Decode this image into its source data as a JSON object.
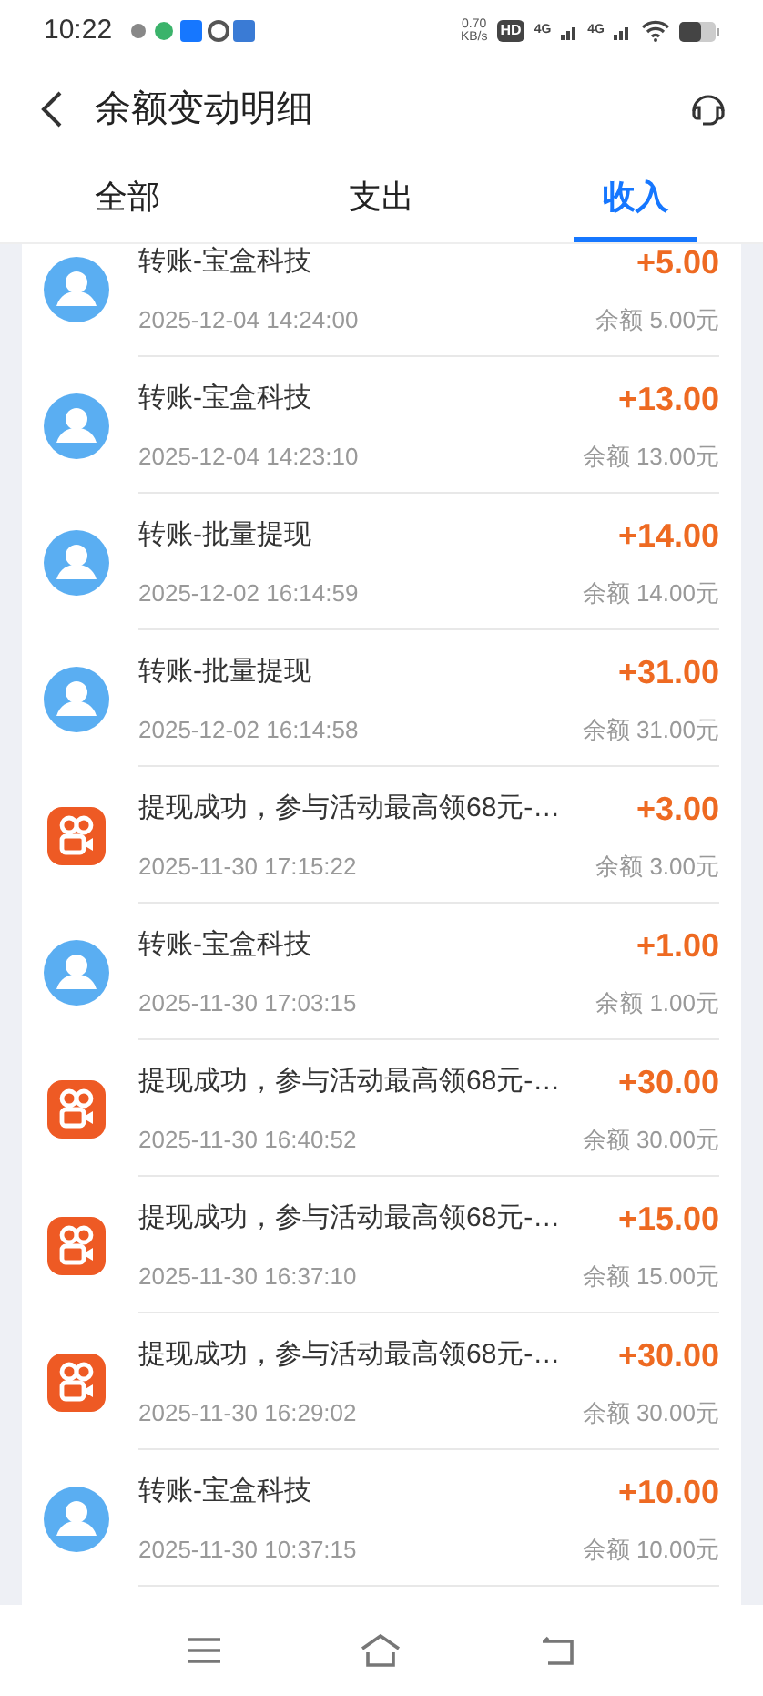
{
  "status_bar": {
    "time": "10:22",
    "net_speed": "0.70",
    "net_unit": "KB/s",
    "hd": "HD",
    "signal_1": "4G",
    "signal_2": "4G"
  },
  "header": {
    "title": "余额变动明细"
  },
  "tabs": [
    {
      "label": "全部",
      "selected": false
    },
    {
      "label": "支出",
      "selected": false
    },
    {
      "label": "收入",
      "selected": true
    }
  ],
  "records": [
    {
      "kind": "person",
      "title": "转账-宝盒科技",
      "time": "2025-12-04 14:24:00",
      "amount": "+5.00",
      "balance": "余额 5.00元"
    },
    {
      "kind": "person",
      "title": "转账-宝盒科技",
      "time": "2025-12-04 14:23:10",
      "amount": "+13.00",
      "balance": "余额 13.00元"
    },
    {
      "kind": "person",
      "title": "转账-批量提现",
      "time": "2025-12-02 16:14:59",
      "amount": "+14.00",
      "balance": "余额 14.00元"
    },
    {
      "kind": "person",
      "title": "转账-批量提现",
      "time": "2025-12-02 16:14:58",
      "amount": "+31.00",
      "balance": "余额 31.00元"
    },
    {
      "kind": "app",
      "title": "提现成功，参与活动最高领68元-…",
      "time": "2025-11-30 17:15:22",
      "amount": "+3.00",
      "balance": "余额 3.00元"
    },
    {
      "kind": "person",
      "title": "转账-宝盒科技",
      "time": "2025-11-30 17:03:15",
      "amount": "+1.00",
      "balance": "余额 1.00元"
    },
    {
      "kind": "app",
      "title": "提现成功，参与活动最高领68元-…",
      "time": "2025-11-30 16:40:52",
      "amount": "+30.00",
      "balance": "余额 30.00元"
    },
    {
      "kind": "app",
      "title": "提现成功，参与活动最高领68元-…",
      "time": "2025-11-30 16:37:10",
      "amount": "+15.00",
      "balance": "余额 15.00元"
    },
    {
      "kind": "app",
      "title": "提现成功，参与活动最高领68元-…",
      "time": "2025-11-30 16:29:02",
      "amount": "+30.00",
      "balance": "余额 30.00元"
    },
    {
      "kind": "person",
      "title": "转账-宝盒科技",
      "time": "2025-11-30 10:37:15",
      "amount": "+10.00",
      "balance": "余额 10.00元"
    }
  ]
}
